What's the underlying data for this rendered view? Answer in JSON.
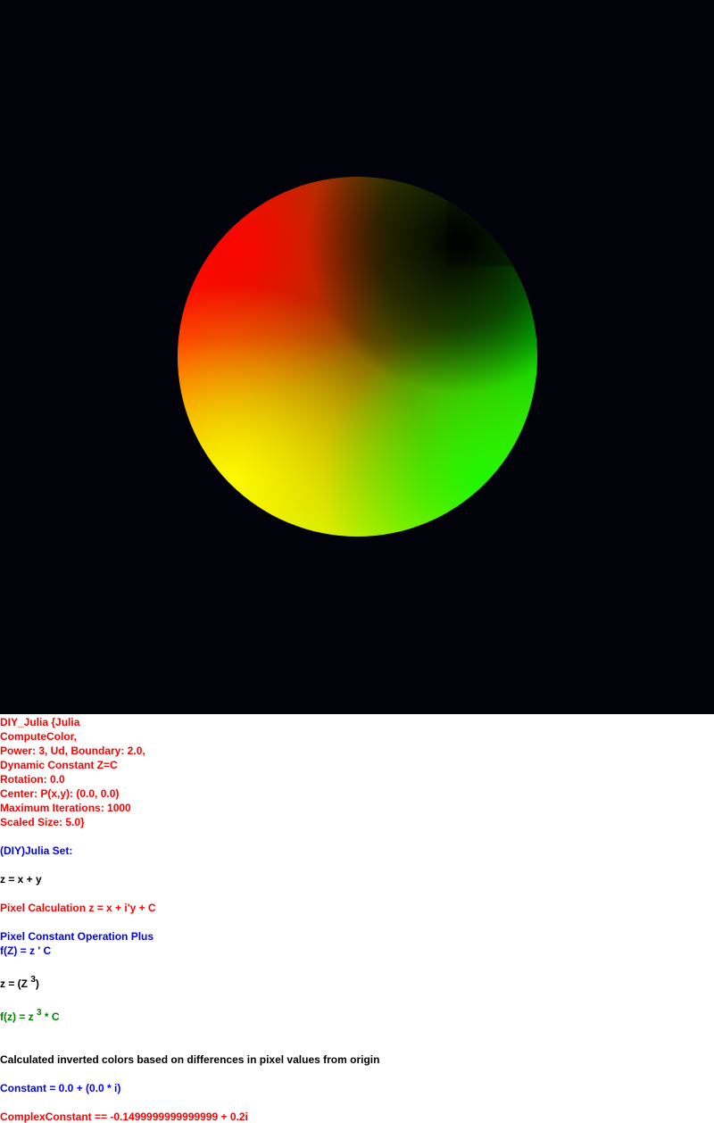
{
  "colors": {
    "canvas_background": "#02030a",
    "text_red": "#ff0000",
    "text_blue": "#0000ff",
    "text_black": "#000000",
    "text_green": "#008000"
  },
  "info": {
    "lines": [
      "DIY_Julia {Julia",
      "ComputeColor,",
      "Power: 3, Ud, Boundary: 2.0,",
      "Dynamic Constant Z=C",
      "Rotation: 0.0",
      "Center: P(x,y): (0.0, 0.0)",
      "Maximum Iterations: 1000",
      "Scaled Size: 5.0}"
    ]
  },
  "formula": {
    "set_title": "(DIY)Julia Set:",
    "z_def": "z = x + y",
    "pixel_calc": "Pixel Calculation z = x + i'y + C",
    "operation": "Pixel Constant Operation Plus",
    "fz_def": "f(Z) = z ' C",
    "z_power_pre": "z = (Z ",
    "z_power_exp": "3",
    "z_power_post": ")",
    "fz_power_pre": "f(z) = z ",
    "fz_power_exp": "3",
    "fz_power_post": " * C",
    "color_note": "Calculated inverted colors based on differences in pixel values from origin",
    "constant": "Constant = 0.0 + (0.0 * i)",
    "complex_constant": "ComplexConstant == -0.1499999999999999 + 0.2i"
  }
}
